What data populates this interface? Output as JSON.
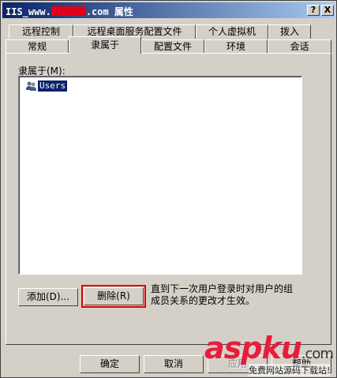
{
  "window": {
    "title_prefix": "IIS_www.",
    "title_suffix": ".com 属性",
    "help_button": "?",
    "close_button": "X"
  },
  "tabs_row1": [
    "远程控制",
    "远程桌面服务配置文件",
    "个人虚拟机",
    "拨入"
  ],
  "tabs_row2": [
    "常规",
    "隶属于",
    "配置文件",
    "环境",
    "会话"
  ],
  "active_tab": "隶属于",
  "member_of": {
    "label": "隶属于(M):",
    "items": [
      {
        "name": "Users",
        "selected": true
      }
    ]
  },
  "actions": {
    "add_label": "添加(D)...",
    "remove_label": "删除(R)",
    "note": "直到下一次用户登录时对用户的组成员关系的更改才生效。"
  },
  "footer": {
    "ok_label": "确定",
    "cancel_label": "取消",
    "apply_label": "应用",
    "help_label": "帮助"
  },
  "watermark": {
    "brand": "aspku",
    "domain": ".com",
    "tagline": "免费网站源码下载站!"
  },
  "colors": {
    "dialog_bg": "#d4d0c8",
    "title_gradient_start": "#0a246a",
    "title_gradient_end": "#a6caf0",
    "highlight_border": "#e00000",
    "watermark_red": "#e81c3c"
  }
}
